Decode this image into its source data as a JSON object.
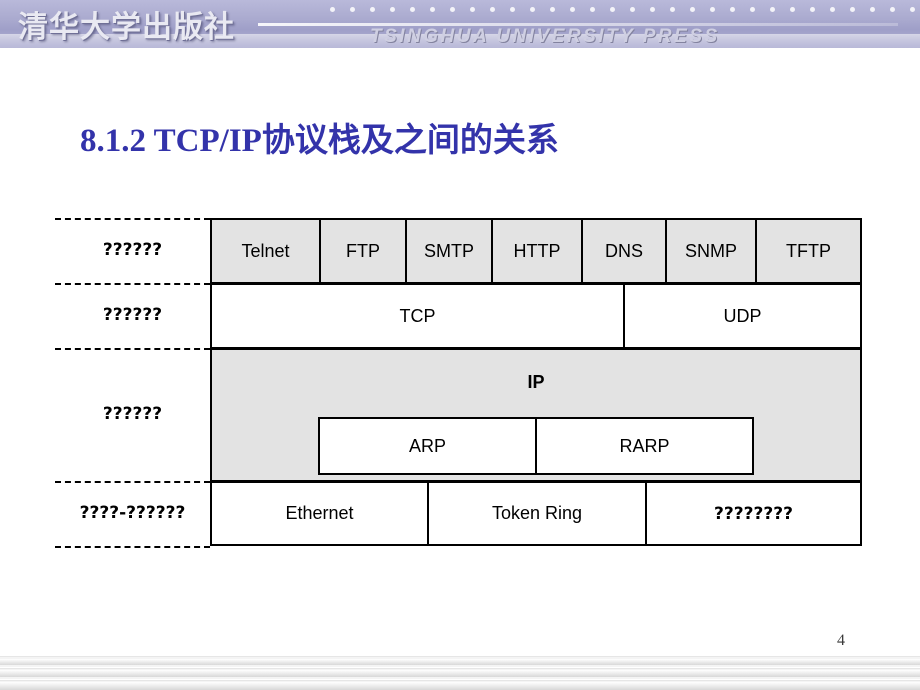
{
  "header": {
    "brand_cn": "清华大学出版社",
    "brand_en": "TSINGHUA UNIVERSITY PRESS"
  },
  "slide": {
    "title": "8.1.2  TCP/IP协议栈及之间的关系",
    "page_number": "4"
  },
  "diagram": {
    "layer_labels": [
      "??????",
      "??????",
      "??????",
      "????-??????"
    ],
    "rows": {
      "application": [
        "Telnet",
        "FTP",
        "SMTP",
        "HTTP",
        "DNS",
        "SNMP",
        "TFTP"
      ],
      "transport": [
        "TCP",
        "UDP"
      ],
      "internet": {
        "main": "IP",
        "sub": [
          "ARP",
          "RARP"
        ]
      },
      "link": [
        "Ethernet",
        "Token Ring",
        "????????"
      ]
    }
  },
  "colors": {
    "title_blue": "#3333aa",
    "cell_gray": "#e3e3e3",
    "banner": "#aaaacf"
  }
}
